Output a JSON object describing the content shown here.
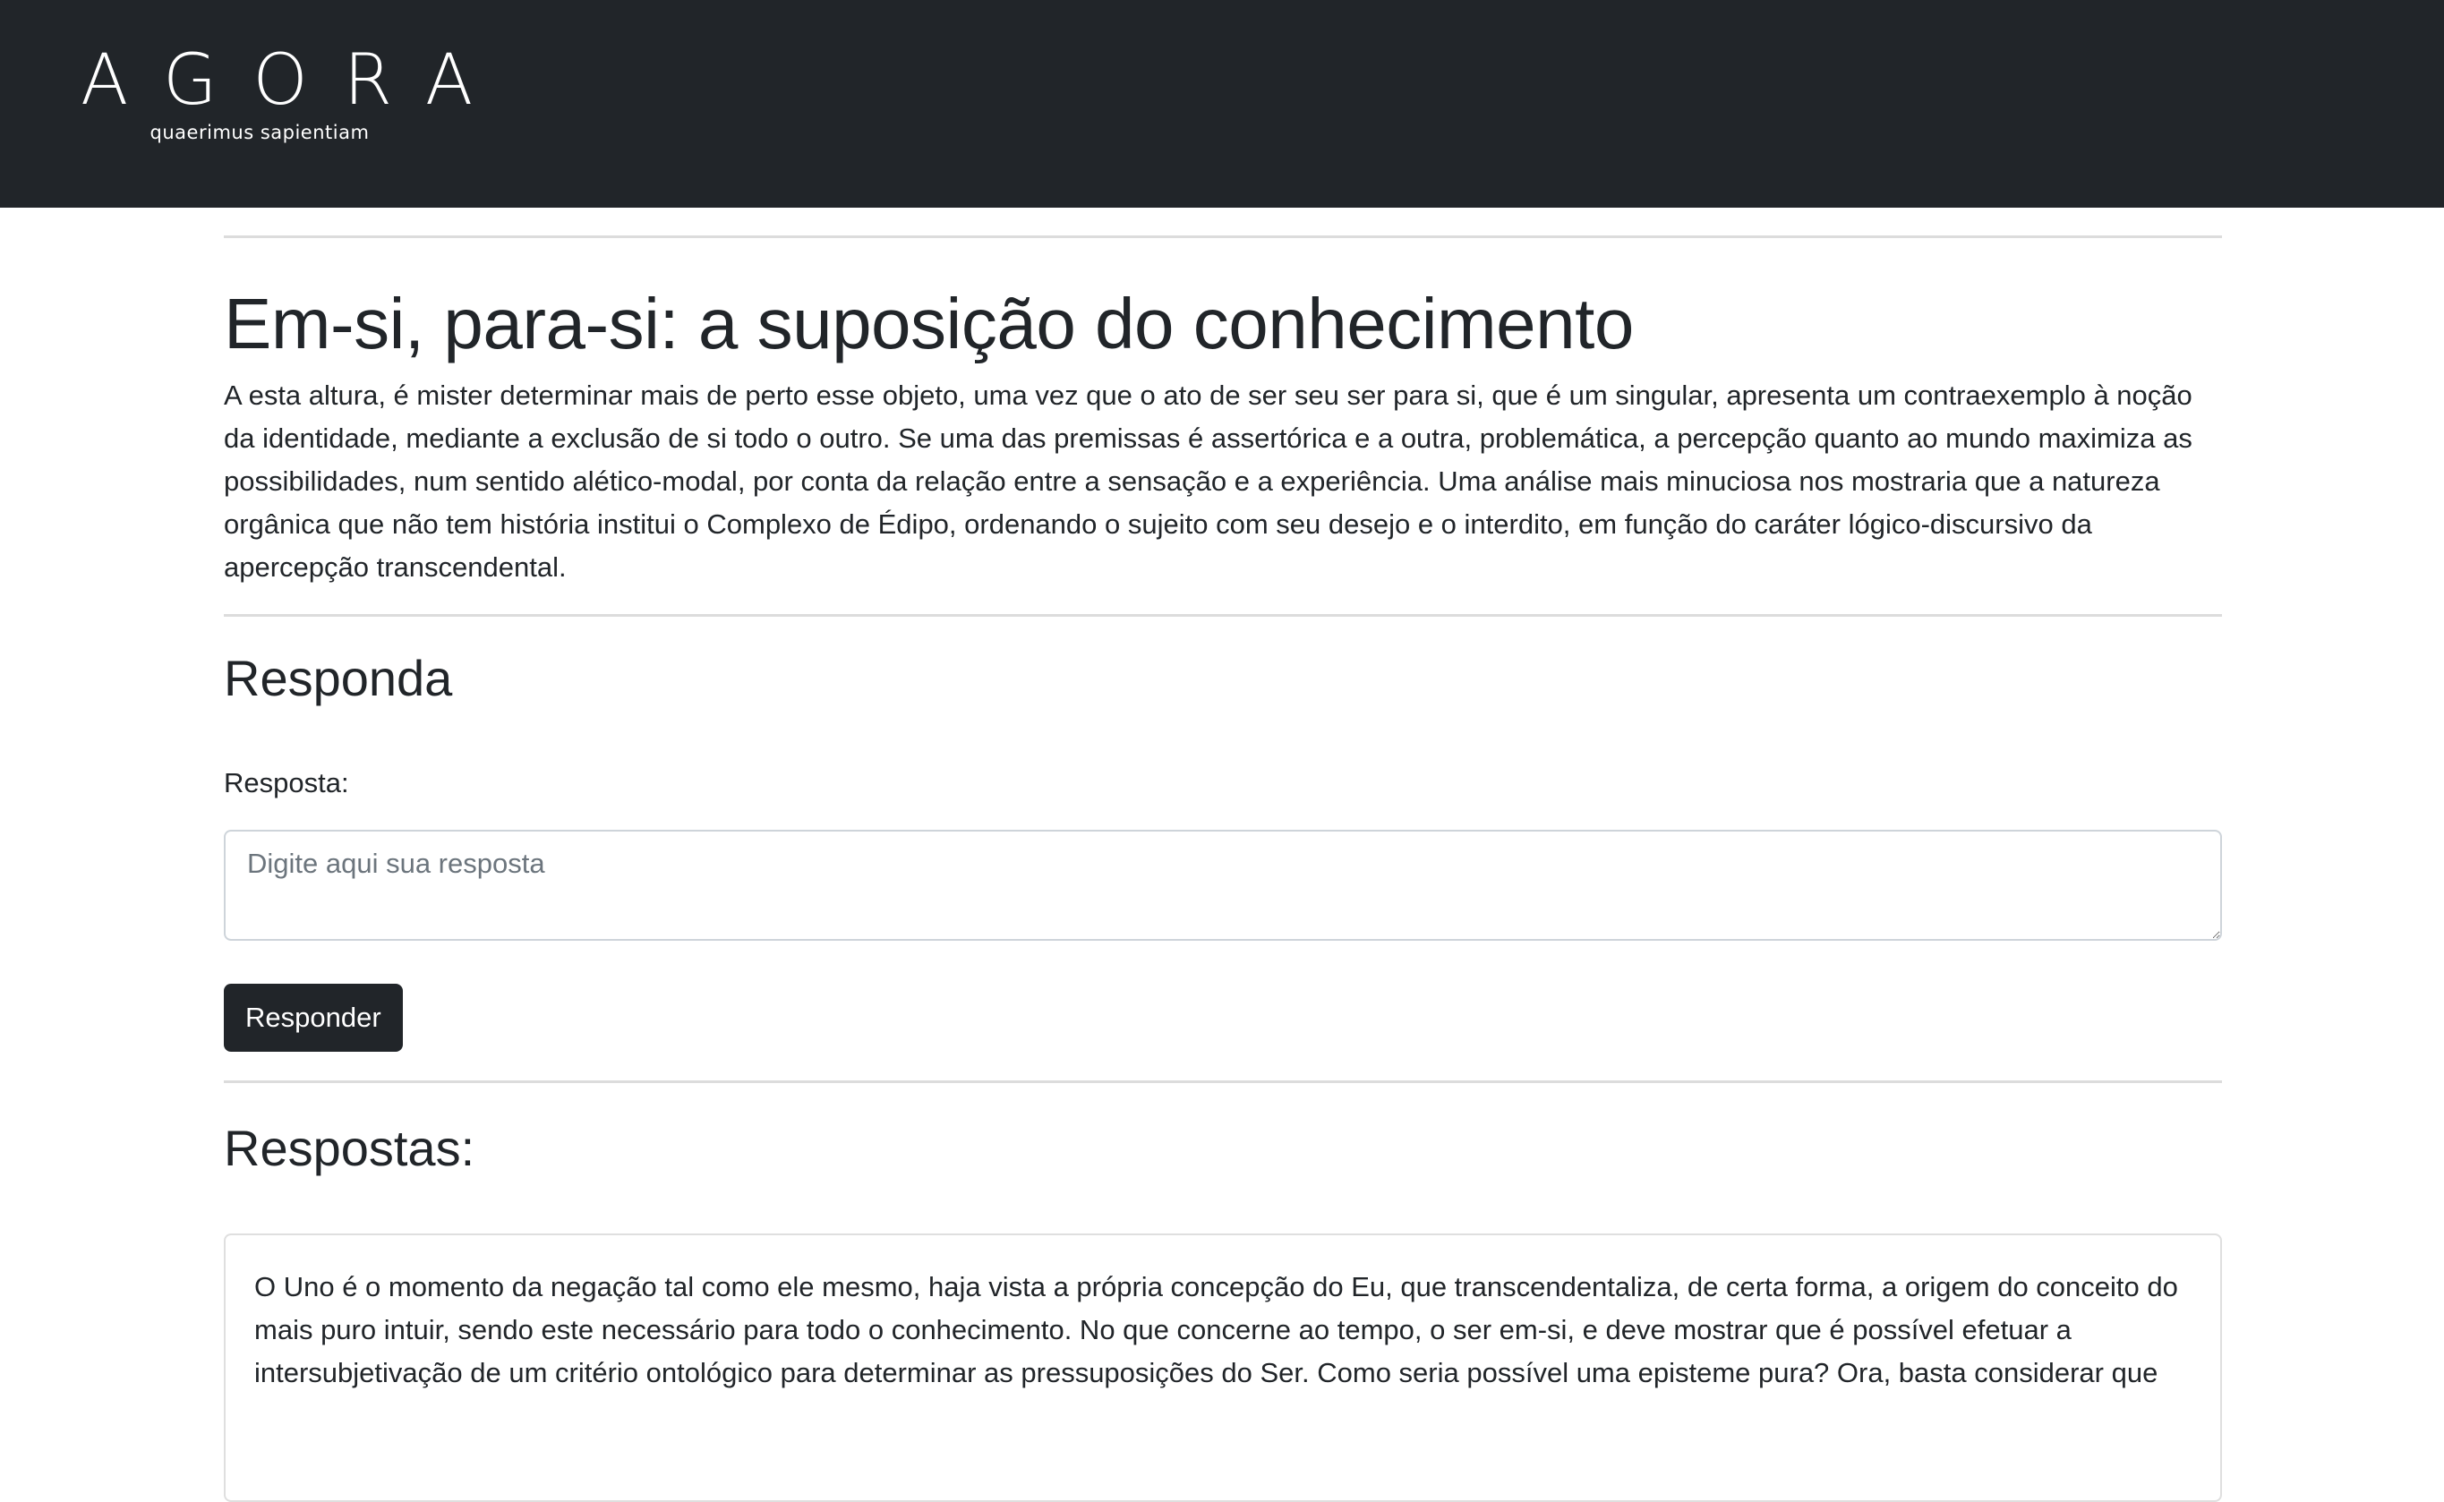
{
  "brand": {
    "name": "AGORA",
    "tagline": "quaerimus sapientiam"
  },
  "post": {
    "title": "Em-si, para-si: a suposição do conhecimento",
    "body": "A esta altura, é mister determinar mais de perto esse objeto, uma vez que o ato de ser seu ser para si, que é um singular, apresenta um contraexemplo à noção da identidade, mediante a exclusão de si todo o outro. Se uma das premissas é assertórica e a outra, problemática, a percepção quanto ao mundo maximiza as possibilidades, num sentido alético-modal, por conta da relação entre a sensação e a experiência. Uma análise mais minuciosa nos mostraria que a natureza orgânica que não tem história institui o Complexo de Édipo, ordenando o sujeito com seu desejo e o interdito, em função do caráter lógico-discursivo da apercepção transcendental."
  },
  "reply_form": {
    "title": "Responda",
    "label": "Resposta:",
    "placeholder": "Digite aqui sua resposta",
    "value": "",
    "submit_label": "Responder"
  },
  "responses": {
    "title": "Respostas:",
    "items": [
      {
        "text": "O Uno é o momento da negação tal como ele mesmo, haja vista a própria concepção do Eu, que transcendentaliza, de certa forma, a origem do conceito do mais puro intuir, sendo este necessário para todo o conhecimento. No que concerne ao tempo, o ser em-si, e deve mostrar que é possível efetuar a intersubjetivação de um critério ontológico para determinar as pressuposições do Ser. Como seria possível uma episteme pura? Ora, basta considerar que"
      }
    ]
  }
}
